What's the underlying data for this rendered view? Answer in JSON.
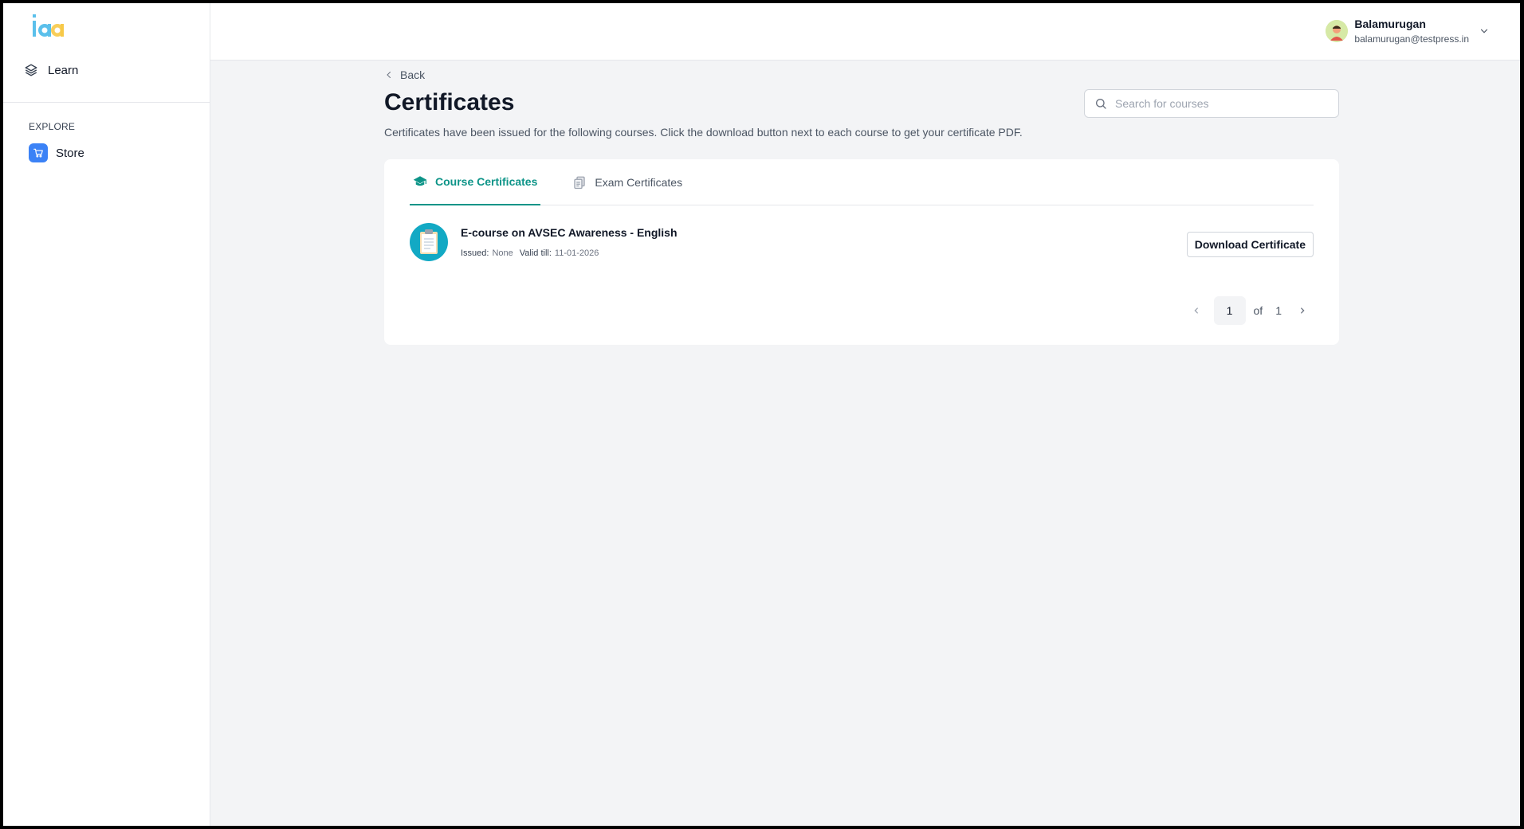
{
  "sidebar": {
    "logo_text": "iaa",
    "learn_label": "Learn",
    "explore_label": "EXPLORE",
    "store_label": "Store"
  },
  "header": {
    "user_name": "Balamurugan",
    "user_email": "balamurugan@testpress.in"
  },
  "page": {
    "back_label": "Back",
    "title": "Certificates",
    "description": "Certificates have been issued for the following courses. Click the download button next to each course to get your certificate PDF.",
    "search_placeholder": "Search for courses"
  },
  "tabs": [
    {
      "label": "Course Certificates",
      "active": true
    },
    {
      "label": "Exam Certificates",
      "active": false
    }
  ],
  "certificates": [
    {
      "title": "E-course on AVSEC Awareness - English",
      "issued_label": "Issued:",
      "issued_value": "None",
      "valid_label": "Valid till:",
      "valid_value": "11-01-2026",
      "button_label": "Download Certificate"
    }
  ],
  "pagination": {
    "current": "1",
    "of_label": "of",
    "total": "1"
  },
  "colors": {
    "accent": "#0d9488",
    "store_icon_bg": "#3b82f6",
    "course_thumb_bg": "#12a9c4"
  }
}
